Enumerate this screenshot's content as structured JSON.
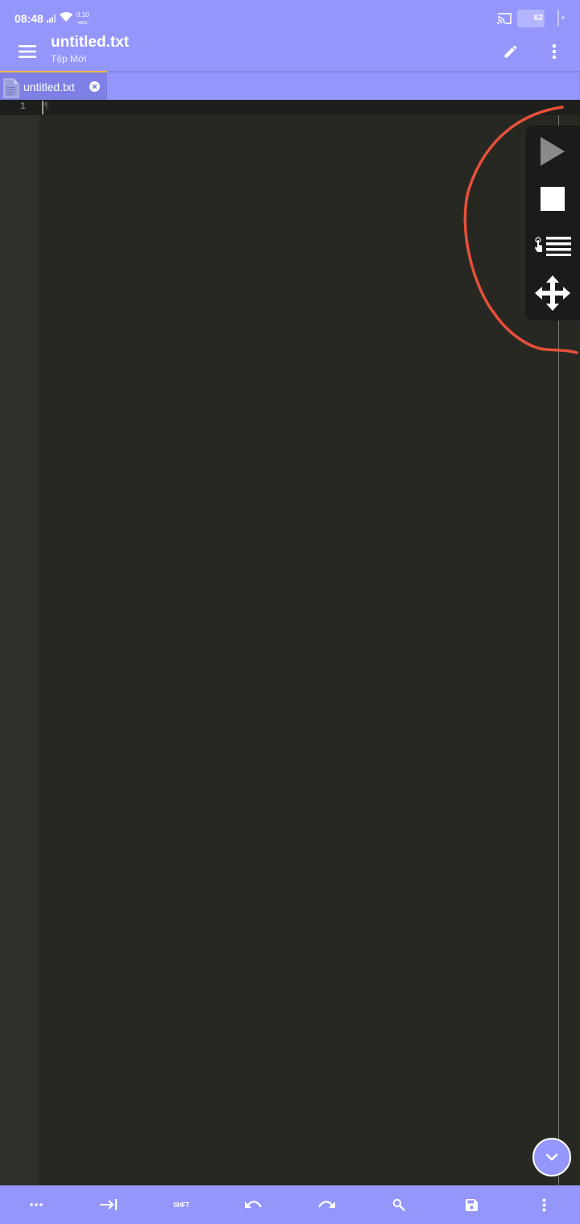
{
  "status_bar": {
    "time": "08:48",
    "net_speed_value": "0.10",
    "net_speed_unit": "KB/S",
    "battery": "62",
    "icons": [
      "signal-icon",
      "wifi-icon",
      "cast-icon",
      "battery-icon"
    ]
  },
  "app_bar": {
    "title": "untitled.txt",
    "subtitle": "Tệp Mới",
    "icons": [
      "menu-icon",
      "pencil-icon",
      "more-vert-icon"
    ]
  },
  "tabs": [
    {
      "label": "untitled.txt",
      "active": true
    }
  ],
  "editor": {
    "lines": [
      {
        "number": "1",
        "text": ""
      }
    ],
    "pilcrow": "¶"
  },
  "floating_panel": {
    "icons": [
      "play-icon",
      "stop-icon",
      "touch-list-icon",
      "move-icon"
    ]
  },
  "bottom_toolbar": {
    "shift_label": "SHFT",
    "icons": [
      "more-horiz-icon",
      "tab-icon",
      "shift-label",
      "undo-icon",
      "redo-icon",
      "search-icon",
      "save-icon",
      "more-vert-icon"
    ]
  },
  "colors": {
    "accent": "#9496fb",
    "tab_active": "#7e80e6",
    "tab_indicator": "#f0b848",
    "editor_bg": "#272822",
    "gutter_bg": "#2f302a",
    "annotation": "#e8503c"
  }
}
